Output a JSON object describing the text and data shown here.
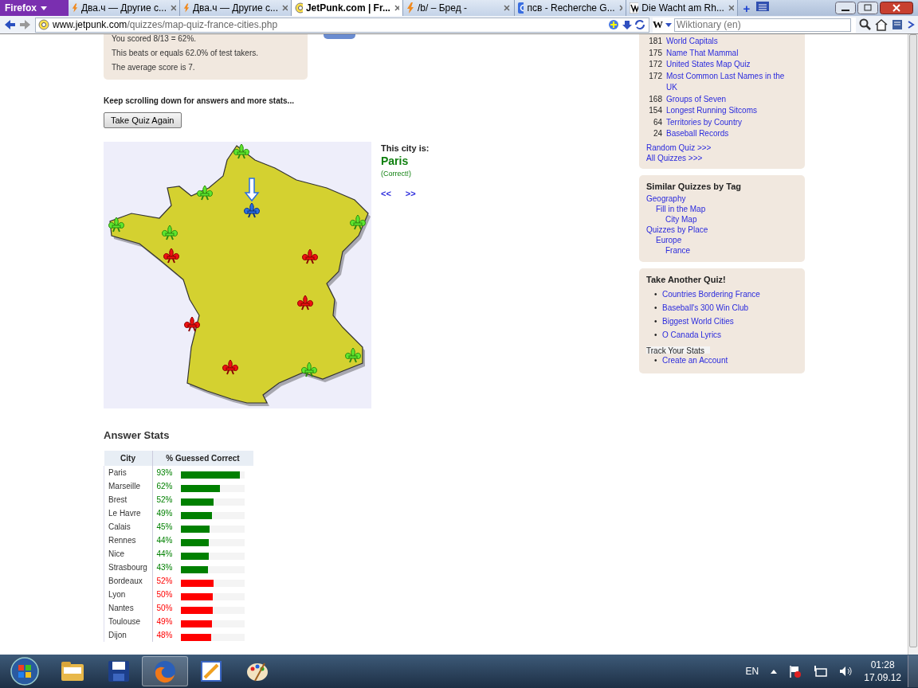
{
  "browser": {
    "menu_button": "Firefox",
    "tabs": [
      {
        "title": "Два.ч — Другие с...",
        "selected": false
      },
      {
        "title": "Два.ч — Другие с...",
        "selected": false
      },
      {
        "title": "JetPunk.com | Fr...",
        "selected": true
      },
      {
        "title": "/b/ – Бред -",
        "selected": false
      },
      {
        "title": "псв - Recherche G...",
        "selected": false
      },
      {
        "title": "Die Wacht am Rh...",
        "selected": false
      }
    ],
    "new_tab": "+",
    "url_host": "www.jetpunk.com",
    "url_path": "/quizzes/map-quiz-france-cities.php",
    "search_engine": "W",
    "search": {
      "placeholder": "Wiktionary (en)"
    }
  },
  "score_box": {
    "lines": [
      "You scored 8/13 = 62%.",
      "This beats or equals 62.0% of test takers.",
      "The average score is 7."
    ]
  },
  "scroll_hint": "Keep scrolling down for answers and more stats...",
  "retake_button": "Take Quiz Again",
  "map": {
    "markers": [
      {
        "kind": "correct"
      },
      {
        "kind": "correct"
      },
      {
        "kind": "current"
      },
      {
        "kind": "correct"
      },
      {
        "kind": "correct"
      },
      {
        "kind": "correct"
      },
      {
        "kind": "wrong"
      },
      {
        "kind": "wrong"
      },
      {
        "kind": "wrong"
      },
      {
        "kind": "wrong"
      },
      {
        "kind": "wrong"
      },
      {
        "kind": "correct"
      },
      {
        "kind": "correct"
      }
    ]
  },
  "city_info": {
    "label": "This city is:",
    "city": "Paris",
    "result": "(Correct!)",
    "prev": "<<",
    "next": ">>"
  },
  "answer_stats": {
    "title": "Answer Stats",
    "columns": [
      "City",
      "% Guessed Correct"
    ],
    "rows": [
      {
        "city": "Paris",
        "percent": "93%",
        "level": 0.93,
        "correct": true
      },
      {
        "city": "Marseille",
        "percent": "62%",
        "level": 0.62,
        "correct": true
      },
      {
        "city": "Brest",
        "percent": "52%",
        "level": 0.52,
        "correct": true
      },
      {
        "city": "Le Havre",
        "percent": "49%",
        "level": 0.49,
        "correct": true
      },
      {
        "city": "Calais",
        "percent": "45%",
        "level": 0.45,
        "correct": true
      },
      {
        "city": "Rennes",
        "percent": "44%",
        "level": 0.44,
        "correct": true
      },
      {
        "city": "Nice",
        "percent": "44%",
        "level": 0.44,
        "correct": true
      },
      {
        "city": "Strasbourg",
        "percent": "43%",
        "level": 0.43,
        "correct": true
      },
      {
        "city": "Bordeaux",
        "percent": "52%",
        "level": 0.52,
        "correct": false
      },
      {
        "city": "Lyon",
        "percent": "50%",
        "level": 0.5,
        "correct": false
      },
      {
        "city": "Nantes",
        "percent": "50%",
        "level": 0.5,
        "correct": false
      },
      {
        "city": "Toulouse",
        "percent": "49%",
        "level": 0.49,
        "correct": false
      },
      {
        "city": "Dijon",
        "percent": "48%",
        "level": 0.48,
        "correct": false
      }
    ]
  },
  "popular_quizzes": {
    "items": [
      {
        "count": "181",
        "title": "World Capitals"
      },
      {
        "count": "175",
        "title": "Name That Mammal"
      },
      {
        "count": "172",
        "title": "United States Map Quiz"
      },
      {
        "count": "172",
        "title": "Most Common Last Names in the UK"
      },
      {
        "count": "168",
        "title": "Groups of Seven"
      },
      {
        "count": "154",
        "title": "Longest Running Sitcoms"
      },
      {
        "count": "64",
        "title": "Territories by Country"
      },
      {
        "count": "24",
        "title": "Baseball Records"
      }
    ],
    "links": [
      "Random Quiz >>>",
      "All Quizzes >>>"
    ]
  },
  "similar_tags": {
    "title": "Similar Quizzes by Tag",
    "tags": [
      {
        "label": "Geography",
        "children": [
          {
            "label": "Fill in the Map",
            "children": [
              {
                "label": "City Map"
              }
            ]
          }
        ]
      },
      {
        "label": "Quizzes by Place",
        "children": [
          {
            "label": "Europe",
            "children": [
              {
                "label": "France"
              }
            ]
          }
        ]
      }
    ]
  },
  "another_quiz": {
    "title": "Take Another Quiz!",
    "items": [
      {
        "bullet": "•",
        "title": "Countries Bordering France"
      },
      {
        "bullet": "•",
        "title": "Baseball's 300 Win Club"
      },
      {
        "bullet": "•",
        "title": "Biggest World Cities"
      },
      {
        "bullet": "•",
        "title": "O Canada Lyrics"
      }
    ],
    "track_title": "Track Your Stats",
    "track_items": [
      {
        "bullet": "•",
        "title": "Create an Account"
      }
    ]
  },
  "taskbar": {
    "apps": [
      {
        "kind": "folder"
      },
      {
        "kind": "floppy"
      },
      {
        "kind": "firefox",
        "selected": true
      },
      {
        "kind": "pencil",
        "selected": false
      },
      {
        "kind": "palette",
        "selected": false
      }
    ],
    "language": "EN",
    "time": "01:28",
    "date": "17.09.12"
  }
}
